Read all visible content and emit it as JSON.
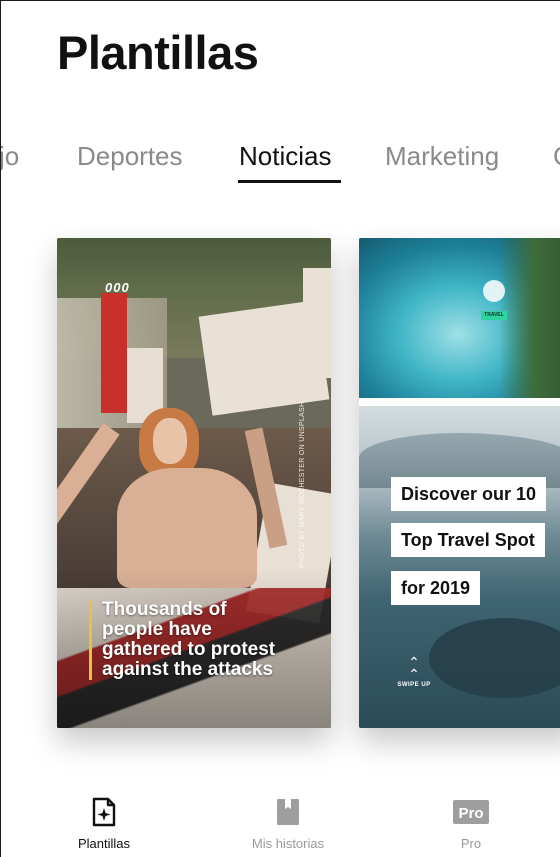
{
  "header": {
    "title": "Plantillas"
  },
  "tabs": [
    {
      "label": "jo",
      "active": false
    },
    {
      "label": "Deportes",
      "active": false
    },
    {
      "label": "Noticias",
      "active": true
    },
    {
      "label": "Marketing",
      "active": false
    },
    {
      "label": "C",
      "active": false
    }
  ],
  "cards": [
    {
      "logo": "000",
      "credit": "PHOTO BY MARY ROCHESTER ON UNSPLASH",
      "headline_lines": [
        "Thousands of",
        "people have",
        "gathered to protest",
        "against the attacks"
      ],
      "accent_color": "#e8c23b"
    },
    {
      "badge": "TRAVEL",
      "lines": [
        "Discover our 10",
        "Top Travel Spot",
        "for 2019"
      ],
      "swipe_label": "SWIPE UP",
      "badge_color": "#2fd3a0"
    }
  ],
  "bottom_nav": [
    {
      "label": "Plantillas",
      "icon": "add-template-icon",
      "active": true
    },
    {
      "label": "Mis historias",
      "icon": "bookmark-icon",
      "active": false
    },
    {
      "label": "Pro",
      "icon": "pro-badge-icon",
      "active": false
    }
  ]
}
